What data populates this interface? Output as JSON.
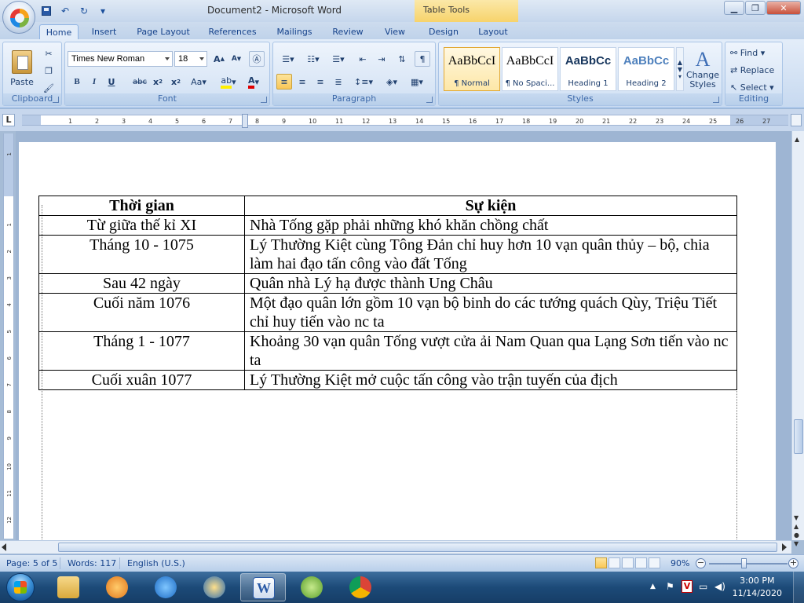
{
  "window": {
    "title": "Document2 - Microsoft Word",
    "contextual_label": "Table Tools"
  },
  "tabs": [
    "Home",
    "Insert",
    "Page Layout",
    "References",
    "Mailings",
    "Review",
    "View",
    "Design",
    "Layout"
  ],
  "ribbon": {
    "clipboard": {
      "label": "Clipboard",
      "paste": "Paste"
    },
    "font": {
      "label": "Font",
      "name": "Times New Roman",
      "size": "18"
    },
    "paragraph": {
      "label": "Paragraph"
    },
    "styles": {
      "label": "Styles",
      "items": [
        {
          "preview": "AaBbCcI",
          "name": "¶ Normal"
        },
        {
          "preview": "AaBbCcI",
          "name": "¶ No Spaci..."
        },
        {
          "preview": "AaBbCc",
          "name": "Heading 1"
        },
        {
          "preview": "AaBbCc",
          "name": "Heading 2"
        }
      ],
      "change_styles": "Change Styles"
    },
    "editing": {
      "label": "Editing",
      "find": "Find",
      "replace": "Replace",
      "select": "Select"
    }
  },
  "ruler": {
    "ticks": [
      "1",
      "2",
      "3",
      "4",
      "5",
      "6",
      "7",
      "8",
      "9",
      "10",
      "11",
      "12",
      "13",
      "14",
      "15",
      "16",
      "17",
      "18",
      "19",
      "20",
      "21",
      "22",
      "23",
      "24",
      "25",
      "26",
      "27"
    ],
    "vticks": [
      "1",
      "1",
      "2",
      "3",
      "4",
      "5",
      "6",
      "7",
      "8",
      "9",
      "10",
      "11",
      "12"
    ]
  },
  "table": {
    "headers": [
      "Thời gian",
      "Sự kiện"
    ],
    "rows": [
      [
        "Từ giữa thế kỉ XI",
        "Nhà Tống gặp phải những khó khăn chồng chất"
      ],
      [
        "Tháng 10 - 1075",
        "Lý Thường Kiệt cùng Tông Đản chỉ huy hơn 10 vạn quân thủy – bộ, chia làm hai đạo tấn công vào đất Tống"
      ],
      [
        "Sau 42 ngày",
        "Quân nhà Lý hạ được thành Ung Châu"
      ],
      [
        "Cuối năm 1076",
        "Một đạo quân lớn gồm 10 vạn bộ binh do các tướng quách Qùy, Triệu Tiết chỉ huy tiến vào nc ta"
      ],
      [
        "Tháng 1 - 1077",
        "Khoảng 30 vạn quân Tống vượt cửa ải Nam Quan qua Lạng Sơn tiến vào nc ta"
      ],
      [
        "Cuối xuân 1077",
        "Lý Thường Kiệt mở cuộc tấn công vào trận tuyến của địch"
      ]
    ]
  },
  "status": {
    "page": "Page: 5 of 5",
    "words": "Words: 117",
    "language": "English (U.S.)",
    "zoom": "90%"
  },
  "taskbar": {
    "time": "3:00 PM",
    "date": "11/14/2020"
  },
  "colors": {
    "ribbon_text": "#15428b",
    "contextual_tab": "#f7d36b",
    "taskbar": "#1c4a78"
  }
}
